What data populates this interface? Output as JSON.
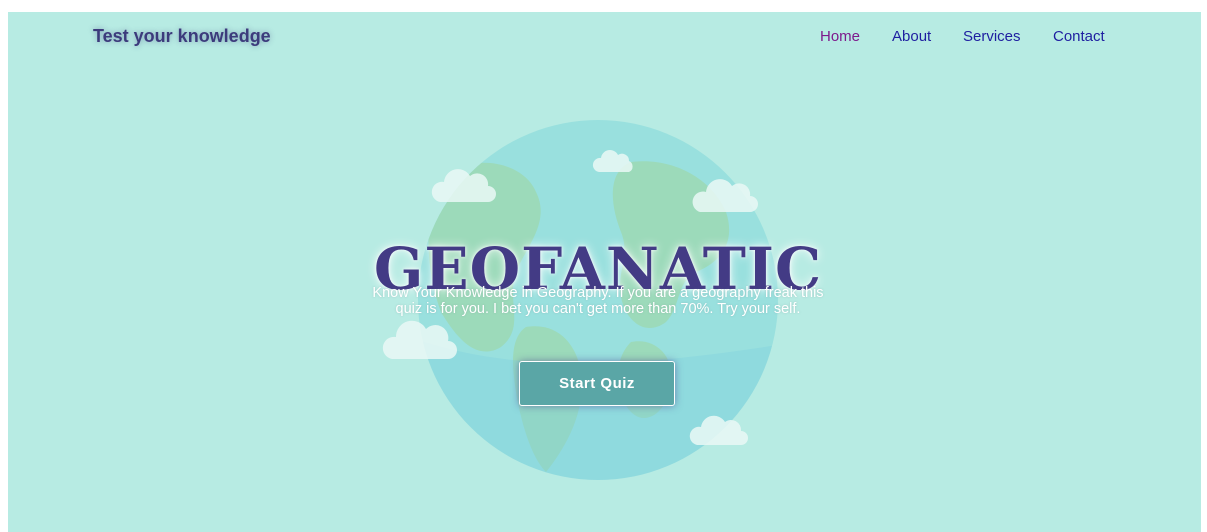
{
  "header": {
    "brand": "Test your knowledge",
    "nav": [
      {
        "label": "Home",
        "active": true
      },
      {
        "label": "About"
      },
      {
        "label": "Services"
      },
      {
        "label": "Contact"
      }
    ]
  },
  "hero": {
    "title": "GEOFANATIC",
    "description": "Know Your Knowledge in Geography. If you are a geography freak this quiz is for you. I bet you can't get more than 70%. Try your self.",
    "button_label": "Start Quiz",
    "illustration": "globe-with-clouds"
  },
  "colors": {
    "background": "#b7ebe3",
    "title": "#433b85",
    "button": "#5aa6a6",
    "nav_active": "#7d1a8c",
    "nav_link": "#1e1ea0"
  }
}
